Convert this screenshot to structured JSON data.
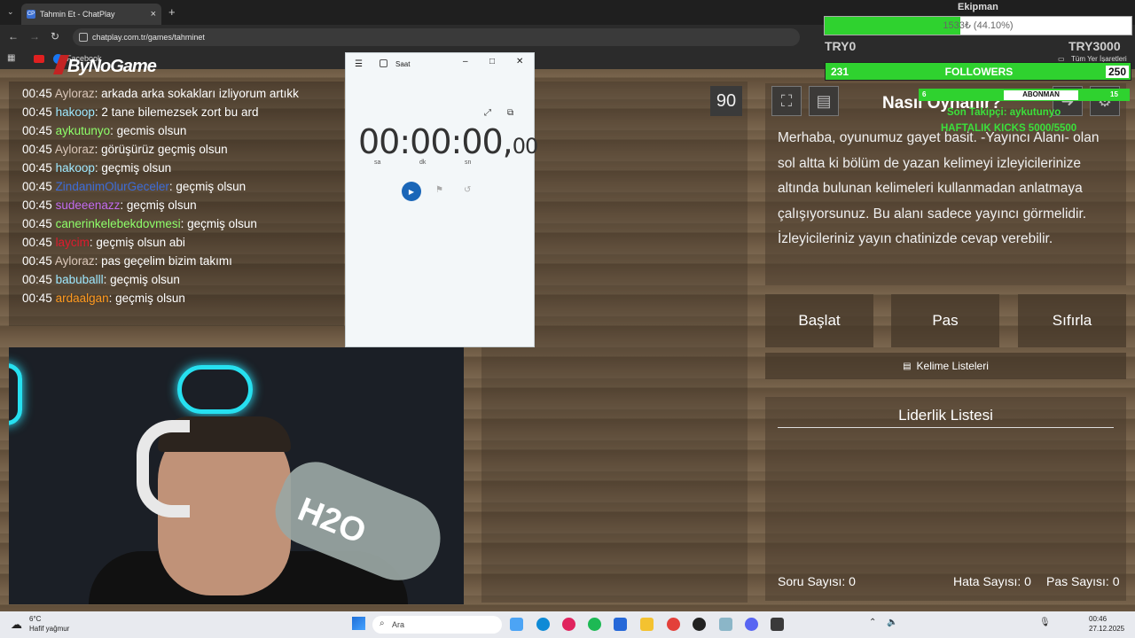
{
  "browser": {
    "tab_title": "Tahmin Et - ChatPlay",
    "tab_favicon_text": "CP",
    "url": "chatplay.com.tr/games/tahminet",
    "bookmark_facebook": "Facebook",
    "bookmark_all": "Tüm Yer İşaretleri"
  },
  "stream_overlay": {
    "logo_text": "ByNoGame",
    "timer_value": "90",
    "equipment_label": "Ekipman",
    "equipment_progress_text": "1533₺ (44.10%)",
    "equipment_fraction": 0.441,
    "try_left": "TRY0",
    "try_right": "TRY3000",
    "followers_left": "231",
    "followers_label": "FOLLOWERS",
    "followers_right": "250",
    "abonman_left": "6",
    "abonman_label": "ABONMAN",
    "abonman_right": "15",
    "last_follower": "Son Takipçi: aykutunyo",
    "weekly_kicks": "HAFTALIK KICKS 5000/5500"
  },
  "chat": {
    "messages": [
      {
        "time": "00:45",
        "user": "Ayloraz",
        "color": "#d9c6b8",
        "text": ": arkada arka sokakları izliyorum artıkk"
      },
      {
        "time": "00:45",
        "user": "hakoop",
        "color": "#9ee8ff",
        "text": ": 2 tane bilemezsek zort bu ard"
      },
      {
        "time": "00:45",
        "user": "aykutunyo",
        "color": "#8fff6a",
        "text": ": gecmis olsun"
      },
      {
        "time": "00:45",
        "user": "Ayloraz",
        "color": "#d9c6b8",
        "text": ": görüşürüz geçmiş olsun"
      },
      {
        "time": "00:45",
        "user": "hakoop",
        "color": "#9ee8ff",
        "text": ": geçmiş olsun"
      },
      {
        "time": "00:45",
        "user": "ZindanimOlurGeceler",
        "color": "#3d6cd8",
        "text": ": geçmiş olsun"
      },
      {
        "time": "00:45",
        "user": "sudeeenazz",
        "color": "#c36cf0",
        "text": ": geçmiş olsun"
      },
      {
        "time": "00:45",
        "user": "canerinkelebekdovmesi",
        "color": "#8fff6a",
        "text": ": geçmiş olsun"
      },
      {
        "time": "00:45",
        "user": "laycim",
        "color": "#e01b2e",
        "text": ": geçmiş olsun abi"
      },
      {
        "time": "00:45",
        "user": "Ayloraz",
        "color": "#d9c6b8",
        "text": ": pas geçelim bizim takımı"
      },
      {
        "time": "00:45",
        "user": "babuballl",
        "color": "#9ee8ff",
        "text": ": geçmiş olsun"
      },
      {
        "time": "00:45",
        "user": "ardaalgan",
        "color": "#ff9a1f",
        "text": ": geçmiş olsun"
      }
    ]
  },
  "clock_window": {
    "title": "Saat",
    "time_main": "00:00:00,",
    "time_frac": "00",
    "unit_h": "sa",
    "unit_m": "dk",
    "unit_s": "sn"
  },
  "game": {
    "howto_title": "Nasıl Oynanır?",
    "howto_text": "Merhaba, oyunumuz gayet basit. -Yayıncı Alanı- olan sol altta ki bölüm de yazan kelimeyi izleyicilerinize altında bulunan kelimeleri kullanmadan anlatmaya çalışıyorsunuz. Bu alanı sadece yayıncı görmelidir. İzleyicileriniz yayın chatinizde cevap verebilir.",
    "start_label": "Başlat",
    "pass_label": "Pas",
    "reset_label": "Sıfırla",
    "word_lists_label": "Kelime Listeleri",
    "leaderboard_title": "Liderlik Listesi",
    "question_count": "Soru Sayısı: 0",
    "error_count": "Hata Sayısı: 0",
    "pass_count": "Pas Sayısı: 0"
  },
  "webcam": {
    "bottle_text": "H2O"
  },
  "taskbar": {
    "temperature": "6°C",
    "weather": "Hafif yağmur",
    "search_placeholder": "Ara",
    "clock_time": "00:46",
    "clock_date": "27.12.2025"
  },
  "colors": {
    "progress_green": "#2fd22f",
    "overlay_text_green": "#3be03b",
    "clock_play_blue": "#1a66b8"
  }
}
